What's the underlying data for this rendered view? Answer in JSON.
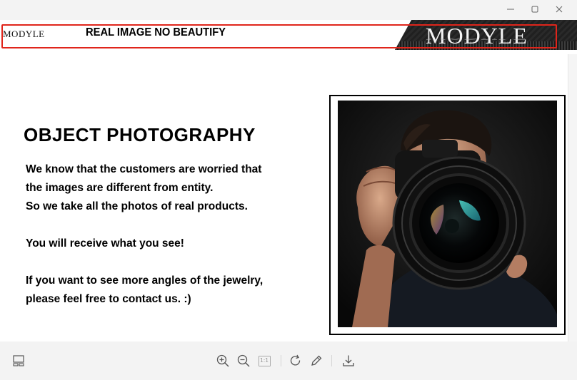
{
  "window": {
    "controls": [
      {
        "name": "minimize-icon"
      },
      {
        "name": "maximize-icon"
      },
      {
        "name": "close-icon"
      }
    ]
  },
  "banner": {
    "brand_small": "MODYLE",
    "slogan": "REAL IMAGE NO BEAUTIFY",
    "brand_large": "MODYLE",
    "highlight_color": "#e0251b"
  },
  "content": {
    "heading": "OBJECT PHOTOGRAPHY",
    "lines": [
      "We know that the customers are worried that",
      "the images are different from entity.",
      "So we take all the photos of real products."
    ],
    "line_receive": "You will receive what you see!",
    "lines_contact": [
      "If you want to see more angles of the jewelry,",
      "please feel free to contact us. :)"
    ]
  },
  "toolbar": {
    "icons": [
      "filmstrip-icon",
      "zoom-in-icon",
      "zoom-out-icon",
      "actual-size-icon",
      "rotate-icon",
      "edit-icon",
      "download-icon"
    ],
    "actual_size_label": "1:1"
  }
}
